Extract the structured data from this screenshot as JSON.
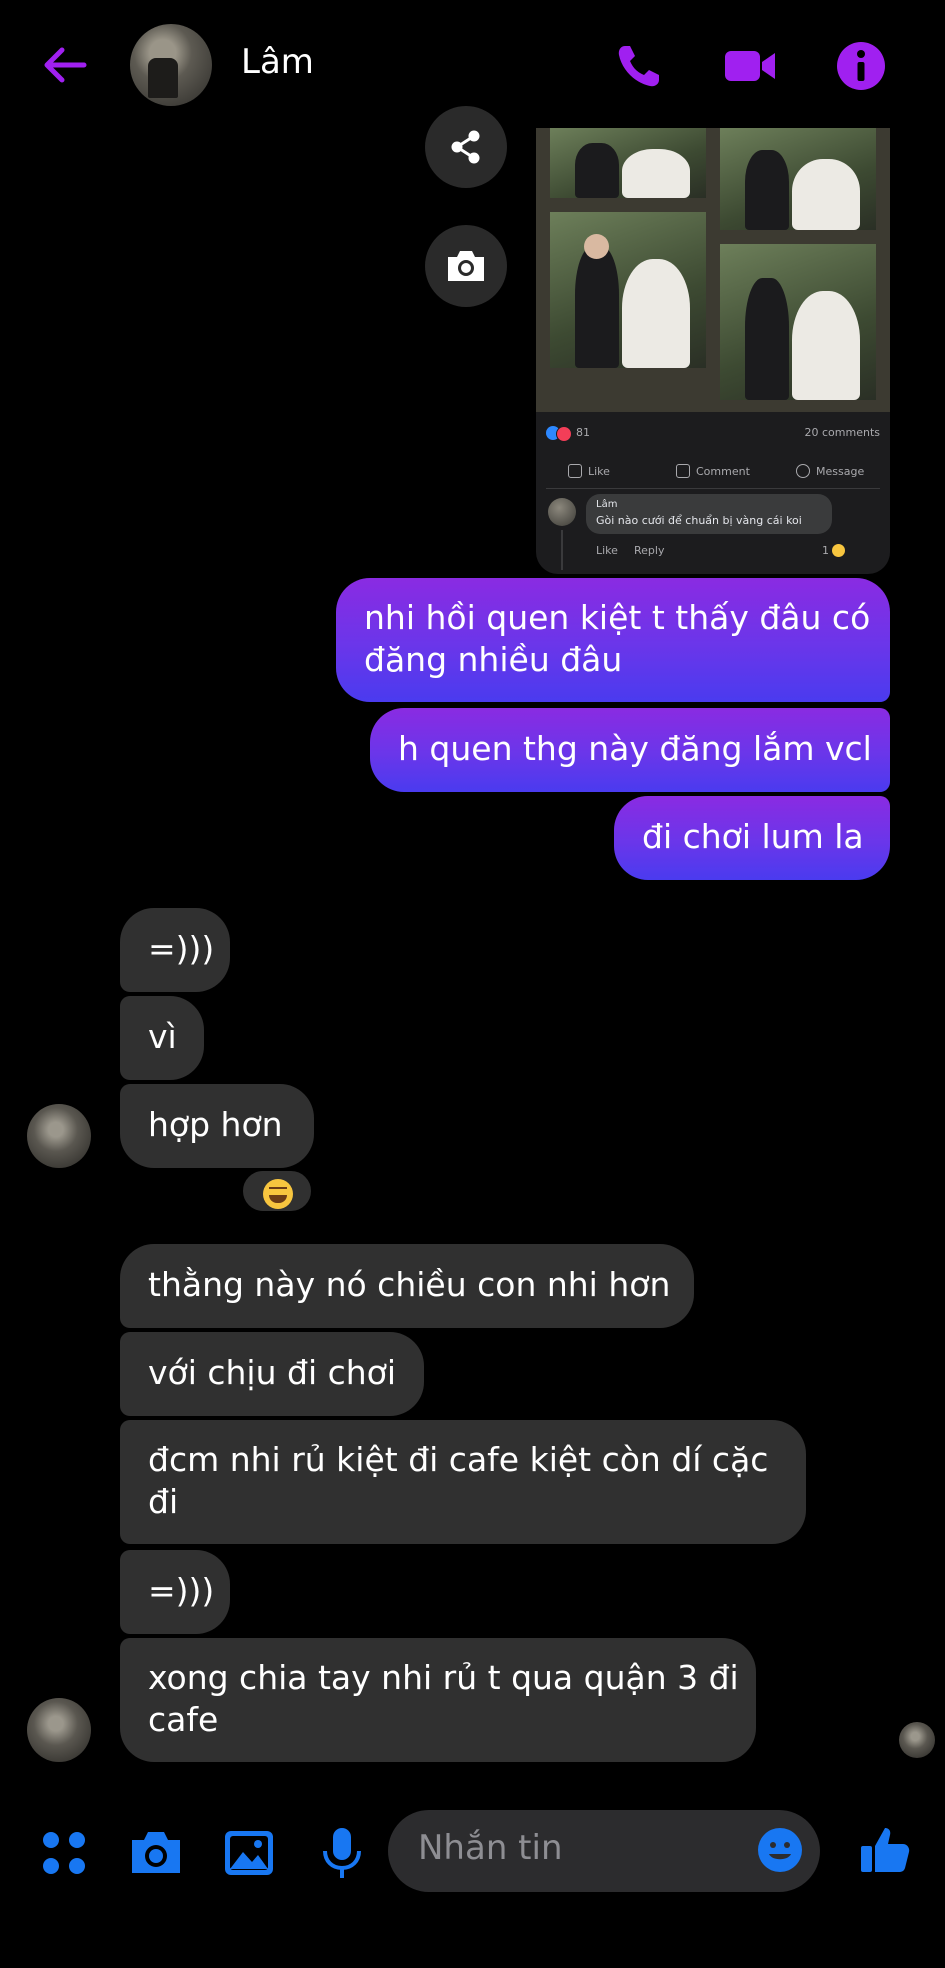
{
  "header": {
    "contact_name": "Lâm",
    "accent_color": "#a020f0",
    "icons": [
      "back-arrow-icon",
      "phone-icon",
      "video-camera-icon",
      "info-icon"
    ]
  },
  "shared_post": {
    "reaction_count": "81",
    "comments_count": "20 comments",
    "actions": {
      "like": "Like",
      "comment": "Comment",
      "message": "Message"
    },
    "comment": {
      "author": "Lâm",
      "text": "Gòi nào cưới để chuẩn bị vàng cái koi",
      "like": "Like",
      "reply": "Reply",
      "reaction_count": "1"
    },
    "side_buttons": [
      "share-icon",
      "camera-icon"
    ]
  },
  "messages": [
    {
      "side": "sent",
      "lines": [
        "nhi hồi quen kiệt t thấy đâu có",
        "đăng nhiều đâu"
      ]
    },
    {
      "side": "sent",
      "lines": [
        "h quen thg này đăng lắm vcl"
      ]
    },
    {
      "side": "sent",
      "lines": [
        "đi chơi lum la"
      ]
    },
    {
      "side": "received",
      "lines": [
        "=)))"
      ]
    },
    {
      "side": "received",
      "lines": [
        "vì"
      ]
    },
    {
      "side": "received",
      "lines": [
        "hợp hơn"
      ],
      "reaction": "laughing-emoji"
    },
    {
      "side": "received",
      "lines": [
        "thằng này nó chiều con nhi hơn"
      ]
    },
    {
      "side": "received",
      "lines": [
        "với chịu đi chơi"
      ]
    },
    {
      "side": "received",
      "lines": [
        "đcm nhi rủ kiệt đi cafe kiệt còn dí cặc",
        "đi"
      ]
    },
    {
      "side": "received",
      "lines": [
        "=)))"
      ]
    },
    {
      "side": "received",
      "lines": [
        "xong chia tay nhi rủ t qua quận 3 đi",
        "cafe"
      ]
    }
  ],
  "composer": {
    "placeholder": "Nhắn tin",
    "icon_color": "#1877f2",
    "icons": [
      "apps-icon",
      "camera-icon",
      "image-icon",
      "microphone-icon",
      "emoji-icon",
      "thumbs-up-icon"
    ]
  },
  "colors": {
    "sent_bubble_top": "#8a2be2",
    "sent_bubble_bottom": "#4a3bef",
    "received_bubble": "#303030",
    "background": "#000000"
  }
}
